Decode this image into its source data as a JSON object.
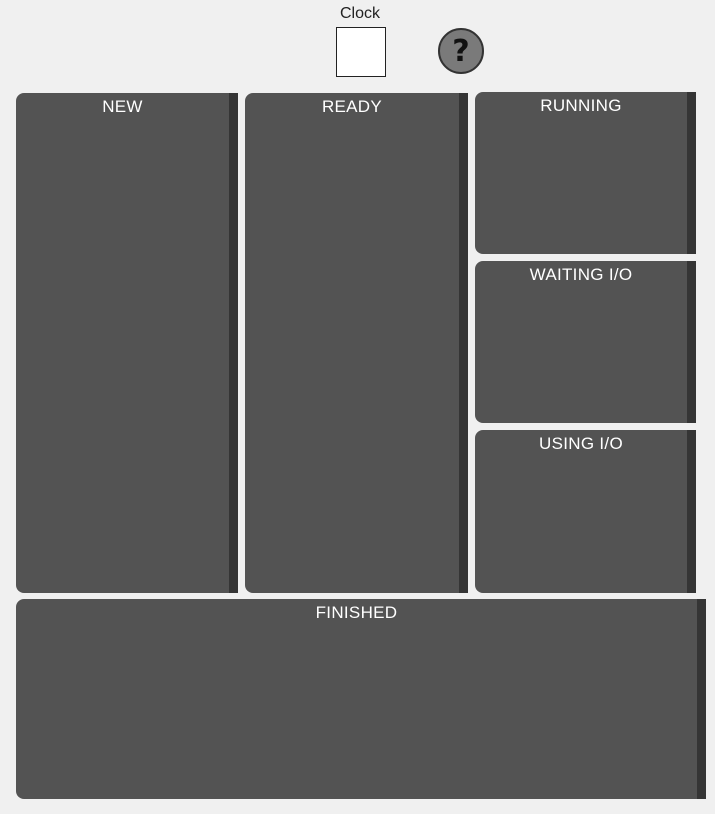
{
  "clock": {
    "label": "Clock",
    "value": ""
  },
  "help": {
    "label": "?"
  },
  "panels": {
    "new": "NEW",
    "ready": "READY",
    "running": "RUNNING",
    "waiting_io": "WAITING I/O",
    "using_io": "USING I/O",
    "finished": "FINISHED"
  },
  "colors": {
    "background": "#f0f0f0",
    "panel": "#535353",
    "scrollbar": "#353535",
    "help_button": "#7a7a7a"
  },
  "icons": {
    "help": "question-mark-icon"
  }
}
